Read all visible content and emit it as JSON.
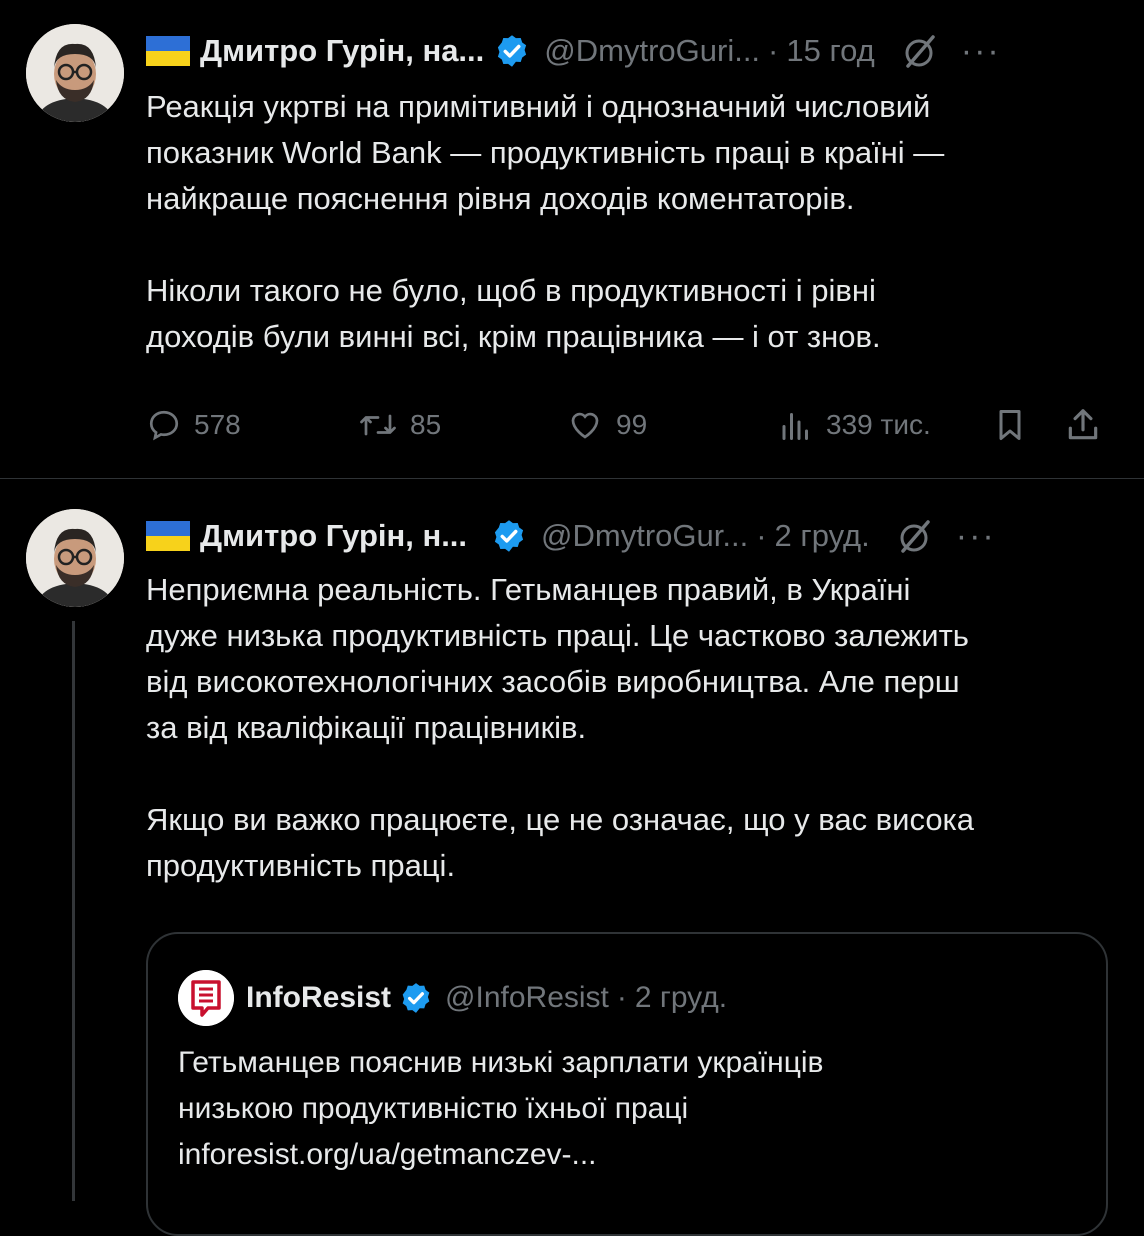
{
  "tweets": [
    {
      "author_name": "Дмитро Гурін, на...",
      "handle": "@DmytroGuri...",
      "separator": "·",
      "time": "15 год",
      "paragraphs": [
        [
          "Реакція укртві на примітивний і однозначний числовий",
          "показник World Bank — продуктивність праці в країні —",
          "найкраще пояснення рівня доходів коментаторів."
        ],
        [
          "Ніколи такого не було, щоб в продуктивності і рівні",
          "доходів були винні всі, крім працівника — і от знов."
        ]
      ],
      "replies": "578",
      "reposts": "85",
      "likes": "99",
      "views": "339 тис."
    },
    {
      "author_name": "Дмитро Гурін, н...",
      "handle": "@DmytroGur...",
      "separator": "·",
      "time": "2 груд.",
      "paragraphs": [
        [
          "Неприємна реальність. Гетьманцев правий, в Україні",
          "дуже низька продуктивність праці. Це частково залежить",
          "від високотехнологічних засобів виробництва. Але перш",
          "за від кваліфікації працівників."
        ],
        [
          "Якщо ви важко працюєте, це не означає, що у вас висока",
          "продуктивність праці."
        ]
      ],
      "quote": {
        "author_name": "InfoResist",
        "handle": "@InfoResist",
        "separator": "·",
        "time": "2 груд.",
        "lines": [
          "Гетьманцев пояснив низькі зарплати українців",
          "низькою продуктивністю їхньої праці",
          "inforesist.org/ua/getmanczev-..."
        ]
      }
    }
  ],
  "icons": {
    "verified": "verified-badge-icon",
    "grok": "grok-icon",
    "more": "more-icon",
    "reply": "reply-icon",
    "repost": "repost-icon",
    "like": "like-icon",
    "views": "views-icon",
    "bookmark": "bookmark-icon",
    "share": "share-icon"
  },
  "colors": {
    "background": "#000000",
    "text": "#e7e9ea",
    "secondary": "#71767b",
    "verified": "#1d9bf0",
    "border": "#2f3336"
  }
}
